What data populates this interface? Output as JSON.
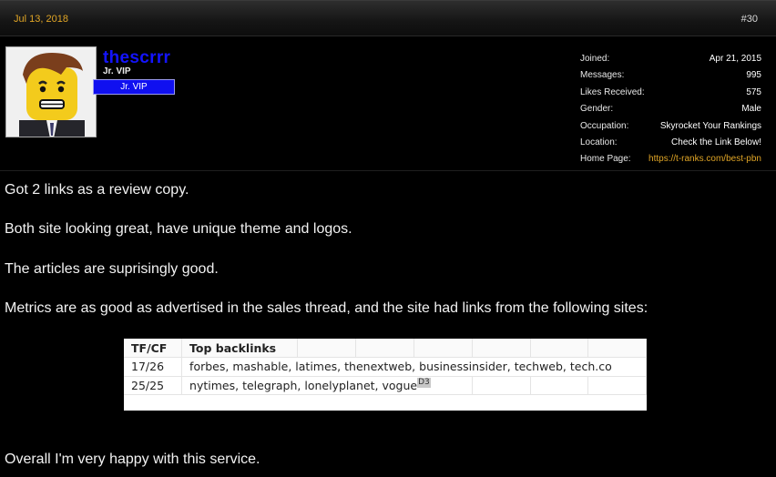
{
  "post": {
    "date": "Jul 13, 2018",
    "number": "#30"
  },
  "user": {
    "username": "thescrrr",
    "title": "Jr. VIP",
    "rank_badge": "Jr. VIP",
    "stats": [
      {
        "label": "Joined:",
        "value": "Apr 21, 2015"
      },
      {
        "label": "Messages:",
        "value": "995"
      },
      {
        "label": "Likes Received:",
        "value": "575"
      },
      {
        "label": "Gender:",
        "value": "Male"
      },
      {
        "label": "Occupation:",
        "value": "Skyrocket Your Rankings"
      },
      {
        "label": "Location:",
        "value": "Check the Link Below!"
      },
      {
        "label": "Home Page:",
        "value": "https://t-ranks.com/best-pbn"
      }
    ]
  },
  "message": {
    "paragraphs": [
      "Got 2 links as a review copy.",
      "Both site looking great, have unique theme and logos.",
      "The articles are suprisingly good.",
      "Metrics are as good as advertised in the sales thread, and the site had links from the following sites:",
      "Overall I'm very happy with this service."
    ],
    "table": {
      "headers": [
        "TF/CF",
        "Top backlinks"
      ],
      "rows": [
        [
          "17/26",
          "forbes, mashable, latimes, thenextweb, businessinsider, techweb, tech.co"
        ],
        [
          "25/25",
          "nytimes, telegraph, lonelyplanet, vogue"
        ]
      ],
      "cell_marker": "D3"
    }
  },
  "colors": {
    "date": "#e0a526",
    "username": "#1414ff",
    "badge": "#1010f0",
    "link": "#e0a526"
  }
}
